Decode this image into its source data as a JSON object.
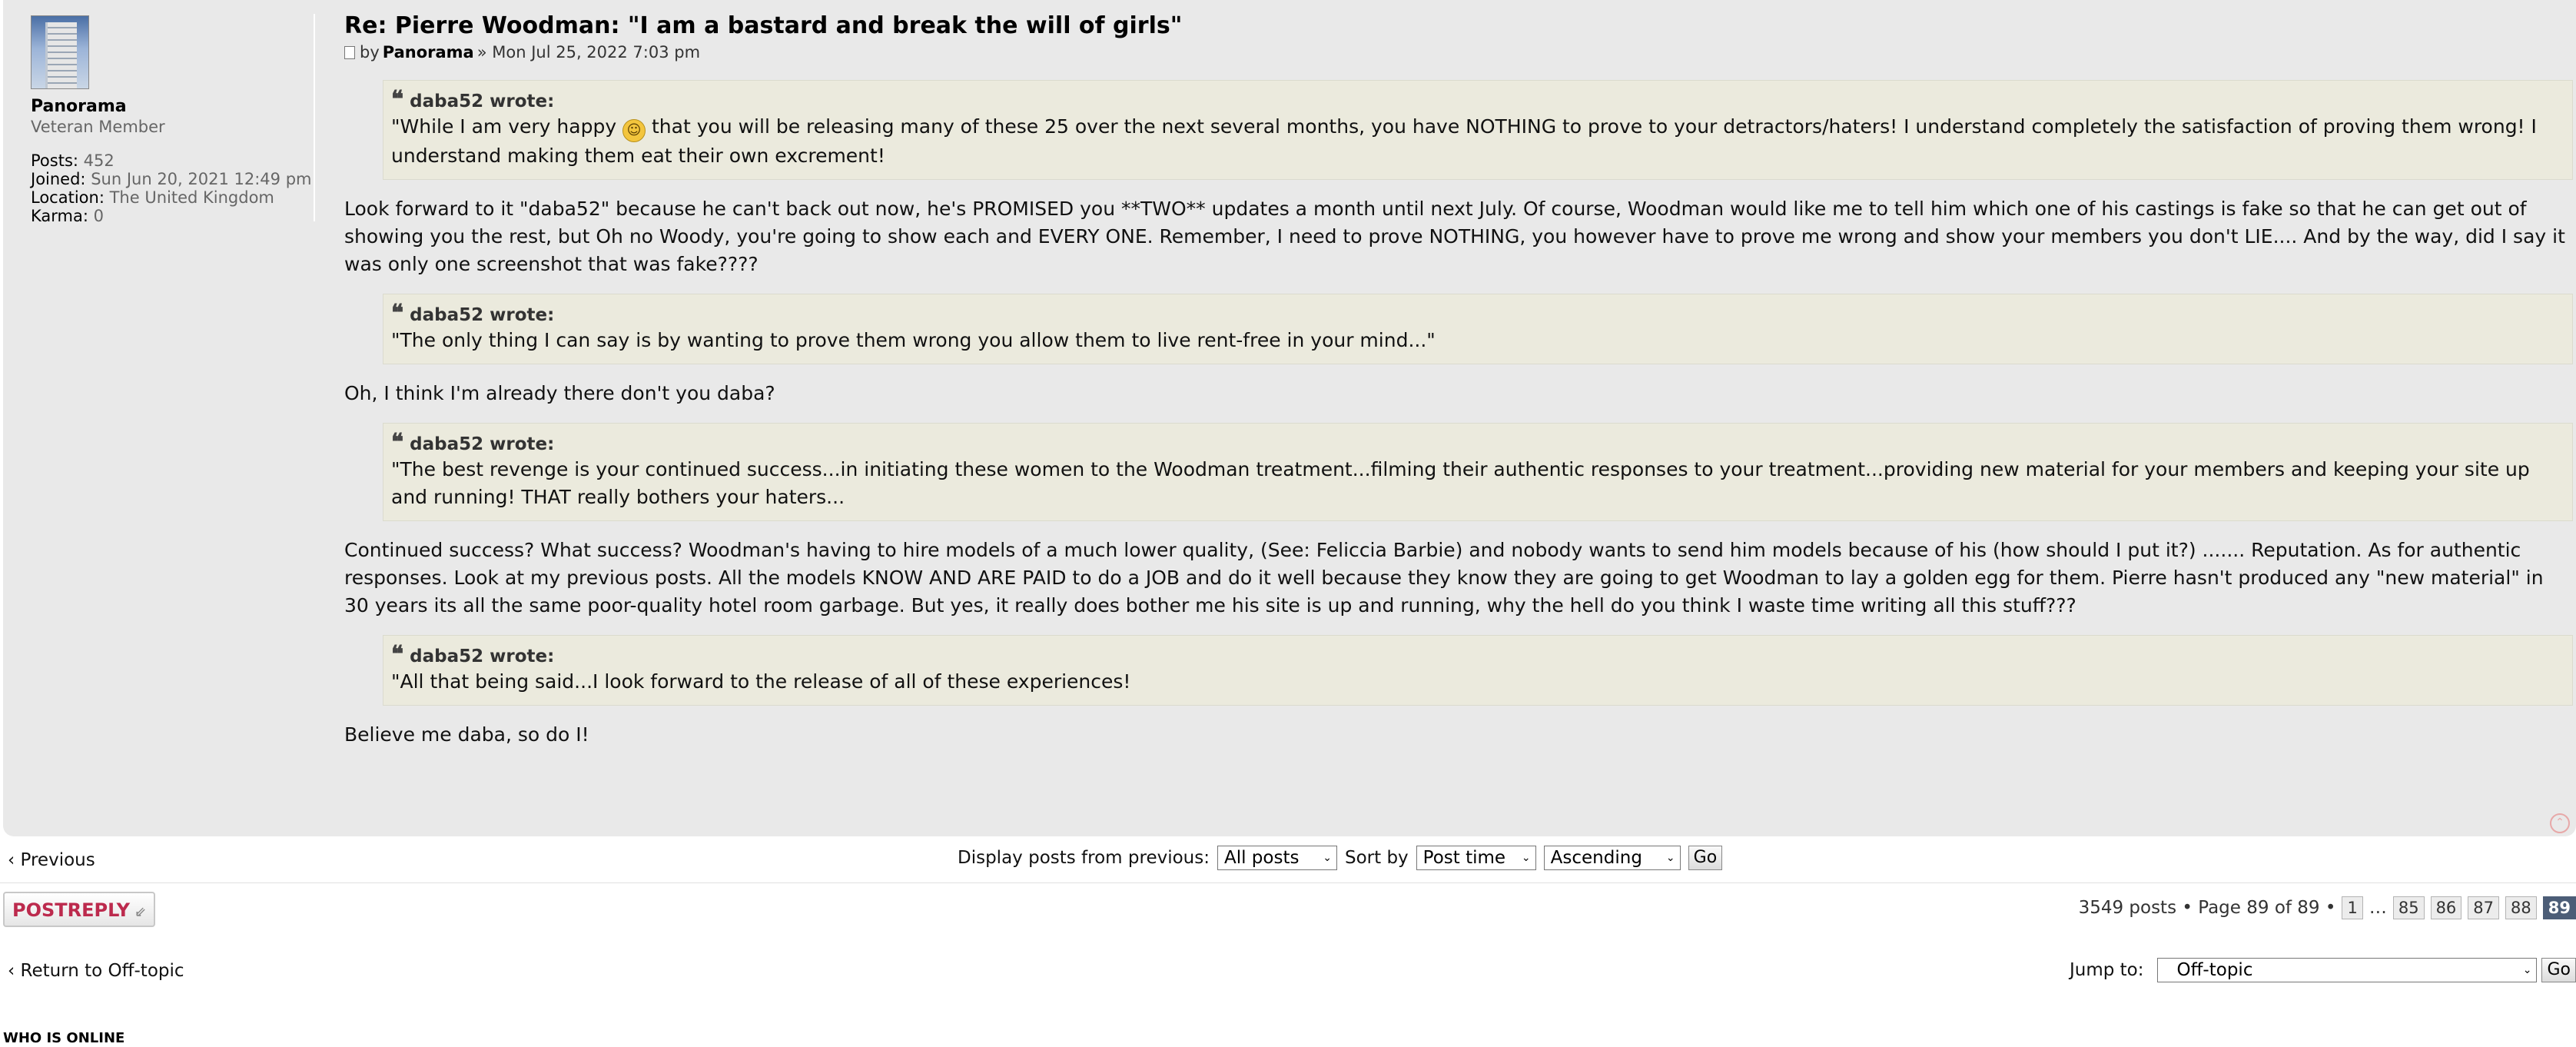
{
  "profile": {
    "username": "Panorama",
    "rank": "Veteran Member",
    "stats": [
      {
        "label": "Posts:",
        "value": "452"
      },
      {
        "label": "Joined:",
        "value": "Sun Jun 20, 2021 12:49 pm"
      },
      {
        "label": "Location:",
        "value": "The United Kingdom"
      },
      {
        "label": "Karma:",
        "value": "0"
      }
    ]
  },
  "post": {
    "title": "Re: Pierre Woodman: \"I am a bastard and break the will of girls\"",
    "by_prefix": "by",
    "author": "Panorama",
    "date": "» Mon Jul 25, 2022 7:03 pm",
    "quote_author": "daba52 wrote:",
    "quotes": [
      {
        "before_emoji": "\"While I am very happy ",
        "after_emoji": " that you will be releasing many of these 25 over the next several months, you have NOTHING to prove to your detractors/haters! I understand completely the satisfaction of proving them wrong! I understand making them eat their own excrement!"
      },
      {
        "text": "\"The only thing I can say is by wanting to prove them wrong you allow them to live rent-free in your mind...\""
      },
      {
        "text": "\"The best revenge is your continued success...in initiating these women to the Woodman treatment...filming their authentic responses to your treatment...providing new material for your members and keeping your site up and running! THAT really bothers your haters..."
      },
      {
        "text": "\"All that being said...I look forward to the release of all of these experiences!"
      }
    ],
    "paragraphs": [
      "Look forward to it \"daba52\" because he can't back out now, he's PROMISED you **TWO** updates a month until next July. Of course, Woodman would like me to tell him which one of his castings is fake so that he can get out of showing you the rest, but Oh no Woody, you're going to show each and EVERY ONE. Remember, I need to prove NOTHING, you however have to prove me wrong and show your members you don't LIE.... And by the way, did I say it was only one screenshot that was fake????",
      "Oh, I think I'm already there don't you daba?",
      "Continued success? What success? Woodman's having to hire models of a much lower quality, (See: Feliccia Barbie) and nobody wants to send him models because of his (how should I put it?) ....... Reputation. As for authentic responses. Look at my previous posts. All the models KNOW AND ARE PAID to do a JOB and do it well because they know they are going to get Woodman to lay a golden egg for them. Pierre hasn't produced any \"new material\" in 30 years its all the same poor-quality hotel room garbage. But yes, it really does bother me his site is up and running, why the hell do you think I waste time writing all this stuff???",
      "Believe me daba, so do I!"
    ]
  },
  "actions": {
    "previous": "Previous",
    "display_label": "Display posts from previous:",
    "display_value": "All posts",
    "sort_label": "Sort by",
    "sort_value": "Post time",
    "order_value": "Ascending",
    "go": "Go"
  },
  "reply": {
    "label": "POSTREPLY"
  },
  "pagination": {
    "summary": "3549 posts • Page 89 of 89 •",
    "pages": [
      "1",
      "…",
      "85",
      "86",
      "87",
      "88",
      "89"
    ],
    "current": "89"
  },
  "footer": {
    "return_link": "Return to Off-topic",
    "jump_label": "Jump to:",
    "jump_value": "Off-topic",
    "jump_go": "Go",
    "who_is_online": "WHO IS ONLINE"
  }
}
